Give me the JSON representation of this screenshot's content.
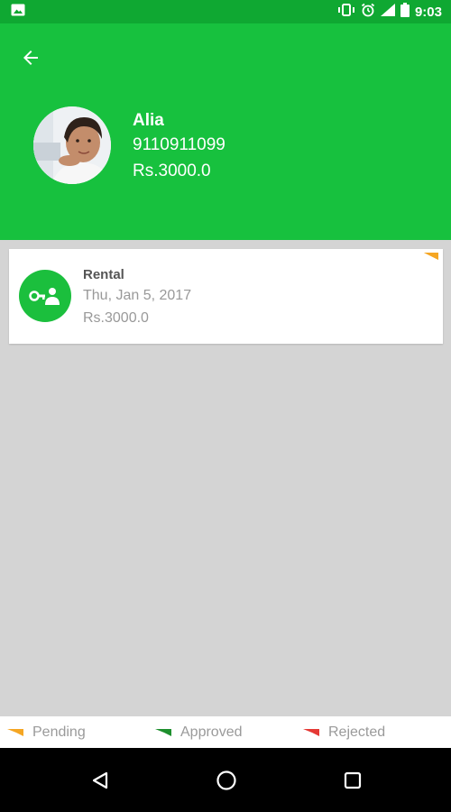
{
  "status_bar": {
    "time": "9:03",
    "icons": [
      "image-icon",
      "vibrate-icon",
      "alarm-icon",
      "signal-icon",
      "battery-icon"
    ]
  },
  "header": {
    "name": "Alia",
    "phone": "9110911099",
    "amount": "Rs.3000.0"
  },
  "cards": [
    {
      "title": "Rental",
      "date": "Thu, Jan 5, 2017",
      "amount": "Rs.3000.0",
      "icon": "rental-key-person-icon",
      "status": "pending"
    }
  ],
  "legend": [
    {
      "label": "Pending",
      "color": "#f5a623"
    },
    {
      "label": "Approved",
      "color": "#1e8f2e"
    },
    {
      "label": "Rejected",
      "color": "#e53935"
    }
  ],
  "colors": {
    "status_bar": "#0fa832",
    "header": "#17c13e",
    "icon_bg": "#1bbf3d",
    "content_bg": "#d4d4d4"
  },
  "nav": [
    "back-triangle-icon",
    "home-circle-icon",
    "recents-square-icon"
  ]
}
